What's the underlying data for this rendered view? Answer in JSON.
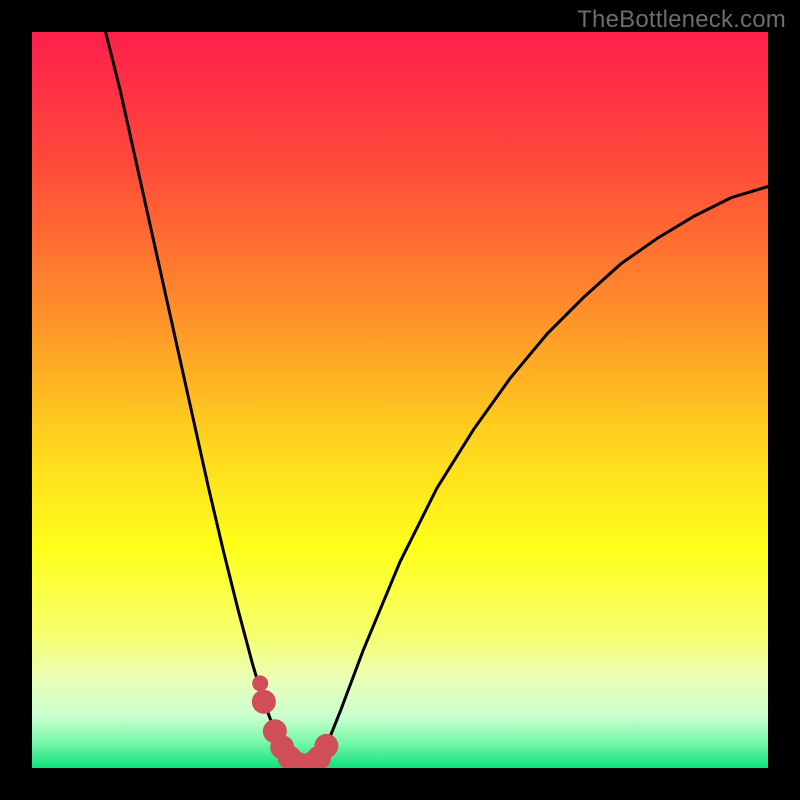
{
  "watermark": "TheBottleneck.com",
  "chart_data": {
    "type": "line",
    "title": "",
    "xlabel": "",
    "ylabel": "",
    "xlim": [
      0,
      100
    ],
    "ylim": [
      0,
      100
    ],
    "gradient_stops": [
      {
        "offset": 0.0,
        "color": "#ff1f4b"
      },
      {
        "offset": 0.18,
        "color": "#ff4a3a"
      },
      {
        "offset": 0.38,
        "color": "#ff8f2a"
      },
      {
        "offset": 0.55,
        "color": "#ffd21e"
      },
      {
        "offset": 0.7,
        "color": "#ffff1a"
      },
      {
        "offset": 0.82,
        "color": "#f6ff6e"
      },
      {
        "offset": 0.88,
        "color": "#e9ffb8"
      },
      {
        "offset": 0.93,
        "color": "#c9ffcf"
      },
      {
        "offset": 0.965,
        "color": "#78f7a9"
      },
      {
        "offset": 1.0,
        "color": "#0fe27d"
      }
    ],
    "series": [
      {
        "name": "bottleneck-curve",
        "type": "line",
        "x": [
          10.0,
          12.0,
          14.0,
          16.0,
          18.0,
          20.0,
          22.0,
          24.0,
          26.0,
          28.0,
          30.0,
          31.5,
          33.0,
          34.0,
          35.0,
          36.0,
          37.0,
          38.0,
          39.0,
          40.0,
          42.0,
          45.0,
          50.0,
          55.0,
          60.0,
          65.0,
          70.0,
          75.0,
          80.0,
          85.0,
          90.0,
          95.0,
          100.0
        ],
        "y": [
          100.0,
          92.0,
          83.0,
          74.0,
          65.0,
          56.0,
          47.0,
          38.0,
          29.5,
          21.5,
          14.0,
          9.0,
          5.0,
          2.8,
          1.4,
          0.6,
          0.3,
          0.6,
          1.4,
          3.0,
          8.0,
          16.0,
          28.0,
          38.0,
          46.0,
          53.0,
          59.0,
          64.0,
          68.5,
          72.0,
          75.0,
          77.5,
          79.0
        ]
      },
      {
        "name": "optimal-band",
        "type": "scatter",
        "x": [
          31.5,
          33.0,
          34.0,
          35.0,
          36.0,
          37.0,
          38.0,
          39.0,
          40.0
        ],
        "y": [
          9.0,
          5.0,
          2.8,
          1.4,
          0.6,
          0.3,
          0.6,
          1.4,
          3.0
        ],
        "marker_color": "#cf4e58",
        "marker_radius_px": 12
      }
    ],
    "optimal_x": 37.0
  }
}
